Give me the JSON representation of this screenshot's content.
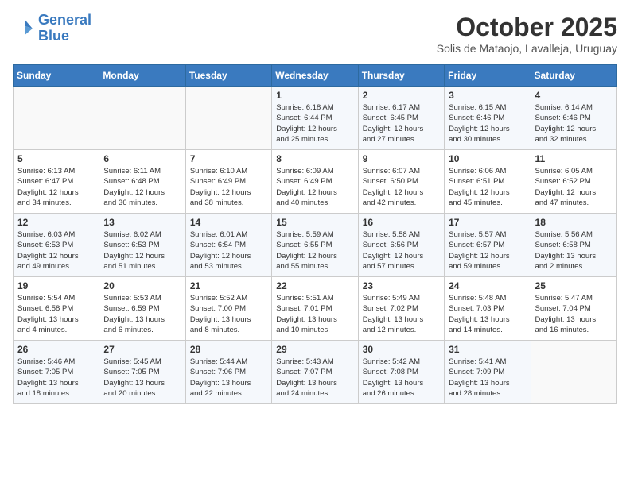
{
  "header": {
    "logo_line1": "General",
    "logo_line2": "Blue",
    "month": "October 2025",
    "location": "Solis de Mataojo, Lavalleja, Uruguay"
  },
  "weekdays": [
    "Sunday",
    "Monday",
    "Tuesday",
    "Wednesday",
    "Thursday",
    "Friday",
    "Saturday"
  ],
  "weeks": [
    [
      {
        "day": "",
        "info": ""
      },
      {
        "day": "",
        "info": ""
      },
      {
        "day": "",
        "info": ""
      },
      {
        "day": "1",
        "info": "Sunrise: 6:18 AM\nSunset: 6:44 PM\nDaylight: 12 hours\nand 25 minutes."
      },
      {
        "day": "2",
        "info": "Sunrise: 6:17 AM\nSunset: 6:45 PM\nDaylight: 12 hours\nand 27 minutes."
      },
      {
        "day": "3",
        "info": "Sunrise: 6:15 AM\nSunset: 6:46 PM\nDaylight: 12 hours\nand 30 minutes."
      },
      {
        "day": "4",
        "info": "Sunrise: 6:14 AM\nSunset: 6:46 PM\nDaylight: 12 hours\nand 32 minutes."
      }
    ],
    [
      {
        "day": "5",
        "info": "Sunrise: 6:13 AM\nSunset: 6:47 PM\nDaylight: 12 hours\nand 34 minutes."
      },
      {
        "day": "6",
        "info": "Sunrise: 6:11 AM\nSunset: 6:48 PM\nDaylight: 12 hours\nand 36 minutes."
      },
      {
        "day": "7",
        "info": "Sunrise: 6:10 AM\nSunset: 6:49 PM\nDaylight: 12 hours\nand 38 minutes."
      },
      {
        "day": "8",
        "info": "Sunrise: 6:09 AM\nSunset: 6:49 PM\nDaylight: 12 hours\nand 40 minutes."
      },
      {
        "day": "9",
        "info": "Sunrise: 6:07 AM\nSunset: 6:50 PM\nDaylight: 12 hours\nand 42 minutes."
      },
      {
        "day": "10",
        "info": "Sunrise: 6:06 AM\nSunset: 6:51 PM\nDaylight: 12 hours\nand 45 minutes."
      },
      {
        "day": "11",
        "info": "Sunrise: 6:05 AM\nSunset: 6:52 PM\nDaylight: 12 hours\nand 47 minutes."
      }
    ],
    [
      {
        "day": "12",
        "info": "Sunrise: 6:03 AM\nSunset: 6:53 PM\nDaylight: 12 hours\nand 49 minutes."
      },
      {
        "day": "13",
        "info": "Sunrise: 6:02 AM\nSunset: 6:53 PM\nDaylight: 12 hours\nand 51 minutes."
      },
      {
        "day": "14",
        "info": "Sunrise: 6:01 AM\nSunset: 6:54 PM\nDaylight: 12 hours\nand 53 minutes."
      },
      {
        "day": "15",
        "info": "Sunrise: 5:59 AM\nSunset: 6:55 PM\nDaylight: 12 hours\nand 55 minutes."
      },
      {
        "day": "16",
        "info": "Sunrise: 5:58 AM\nSunset: 6:56 PM\nDaylight: 12 hours\nand 57 minutes."
      },
      {
        "day": "17",
        "info": "Sunrise: 5:57 AM\nSunset: 6:57 PM\nDaylight: 12 hours\nand 59 minutes."
      },
      {
        "day": "18",
        "info": "Sunrise: 5:56 AM\nSunset: 6:58 PM\nDaylight: 13 hours\nand 2 minutes."
      }
    ],
    [
      {
        "day": "19",
        "info": "Sunrise: 5:54 AM\nSunset: 6:58 PM\nDaylight: 13 hours\nand 4 minutes."
      },
      {
        "day": "20",
        "info": "Sunrise: 5:53 AM\nSunset: 6:59 PM\nDaylight: 13 hours\nand 6 minutes."
      },
      {
        "day": "21",
        "info": "Sunrise: 5:52 AM\nSunset: 7:00 PM\nDaylight: 13 hours\nand 8 minutes."
      },
      {
        "day": "22",
        "info": "Sunrise: 5:51 AM\nSunset: 7:01 PM\nDaylight: 13 hours\nand 10 minutes."
      },
      {
        "day": "23",
        "info": "Sunrise: 5:49 AM\nSunset: 7:02 PM\nDaylight: 13 hours\nand 12 minutes."
      },
      {
        "day": "24",
        "info": "Sunrise: 5:48 AM\nSunset: 7:03 PM\nDaylight: 13 hours\nand 14 minutes."
      },
      {
        "day": "25",
        "info": "Sunrise: 5:47 AM\nSunset: 7:04 PM\nDaylight: 13 hours\nand 16 minutes."
      }
    ],
    [
      {
        "day": "26",
        "info": "Sunrise: 5:46 AM\nSunset: 7:05 PM\nDaylight: 13 hours\nand 18 minutes."
      },
      {
        "day": "27",
        "info": "Sunrise: 5:45 AM\nSunset: 7:05 PM\nDaylight: 13 hours\nand 20 minutes."
      },
      {
        "day": "28",
        "info": "Sunrise: 5:44 AM\nSunset: 7:06 PM\nDaylight: 13 hours\nand 22 minutes."
      },
      {
        "day": "29",
        "info": "Sunrise: 5:43 AM\nSunset: 7:07 PM\nDaylight: 13 hours\nand 24 minutes."
      },
      {
        "day": "30",
        "info": "Sunrise: 5:42 AM\nSunset: 7:08 PM\nDaylight: 13 hours\nand 26 minutes."
      },
      {
        "day": "31",
        "info": "Sunrise: 5:41 AM\nSunset: 7:09 PM\nDaylight: 13 hours\nand 28 minutes."
      },
      {
        "day": "",
        "info": ""
      }
    ]
  ]
}
